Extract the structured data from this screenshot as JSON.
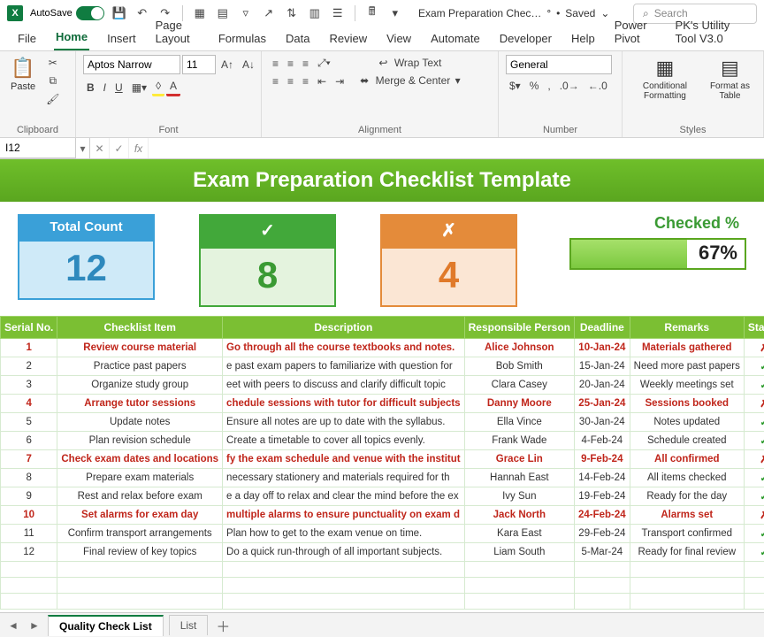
{
  "titlebar": {
    "autosave_label": "AutoSave",
    "autosave_state": "On",
    "doc_name": "Exam Preparation Chec…",
    "saved_status": "Saved",
    "search_placeholder": "Search"
  },
  "tabs": [
    "File",
    "Home",
    "Insert",
    "Page Layout",
    "Formulas",
    "Data",
    "Review",
    "View",
    "Automate",
    "Developer",
    "Help",
    "Power Pivot",
    "PK's Utility Tool V3.0"
  ],
  "active_tab": "Home",
  "ribbon": {
    "paste_label": "Paste",
    "clipboard_label": "Clipboard",
    "font_name": "Aptos Narrow",
    "font_size": "11",
    "font_label": "Font",
    "alignment_label": "Alignment",
    "wrap_text": "Wrap Text",
    "merge_center": "Merge & Center",
    "number_format": "General",
    "number_label": "Number",
    "cond_fmt": "Conditional Formatting",
    "fmt_table": "Format as Table",
    "styles_label": "Styles"
  },
  "formula_bar": {
    "cell_ref": "I12",
    "formula": ""
  },
  "banner_title": "Exam Preparation Checklist Template",
  "cards": {
    "total_label": "Total Count",
    "total_value": "12",
    "checked_value": "8",
    "unchecked_value": "4",
    "pct_label": "Checked %",
    "pct_value": "67%",
    "pct_fill": 67
  },
  "headers": [
    "Serial No.",
    "Checklist Item",
    "Description",
    "Responsible Person",
    "Deadline",
    "Remarks",
    "Status"
  ],
  "rows": [
    {
      "n": "1",
      "item": "Review course material",
      "desc": "Go through all the course textbooks and notes.",
      "who": "Alice Johnson",
      "date": "10-Jan-24",
      "rem": "Materials gathered",
      "ok": false,
      "flag": true
    },
    {
      "n": "2",
      "item": "Practice past papers",
      "desc": "e past exam papers to familiarize with question for",
      "who": "Bob Smith",
      "date": "15-Jan-24",
      "rem": "Need more past papers",
      "ok": true,
      "flag": false
    },
    {
      "n": "3",
      "item": "Organize study group",
      "desc": "eet with peers to discuss and clarify difficult topic",
      "who": "Clara Casey",
      "date": "20-Jan-24",
      "rem": "Weekly meetings set",
      "ok": true,
      "flag": false
    },
    {
      "n": "4",
      "item": "Arrange tutor sessions",
      "desc": "chedule sessions with tutor for difficult subjects",
      "who": "Danny Moore",
      "date": "25-Jan-24",
      "rem": "Sessions booked",
      "ok": false,
      "flag": true
    },
    {
      "n": "5",
      "item": "Update notes",
      "desc": "Ensure all notes are up to date with the syllabus.",
      "who": "Ella Vince",
      "date": "30-Jan-24",
      "rem": "Notes updated",
      "ok": true,
      "flag": false
    },
    {
      "n": "6",
      "item": "Plan revision schedule",
      "desc": "Create a timetable to cover all topics evenly.",
      "who": "Frank Wade",
      "date": "4-Feb-24",
      "rem": "Schedule created",
      "ok": true,
      "flag": false
    },
    {
      "n": "7",
      "item": "Check exam dates and locations",
      "desc": "fy the exam schedule and venue with the institut",
      "who": "Grace Lin",
      "date": "9-Feb-24",
      "rem": "All confirmed",
      "ok": false,
      "flag": true
    },
    {
      "n": "8",
      "item": "Prepare exam materials",
      "desc": "necessary stationery and materials required for th",
      "who": "Hannah East",
      "date": "14-Feb-24",
      "rem": "All items checked",
      "ok": true,
      "flag": false
    },
    {
      "n": "9",
      "item": "Rest and relax before exam",
      "desc": "e a day off to relax and clear the mind before the ex",
      "who": "Ivy Sun",
      "date": "19-Feb-24",
      "rem": "Ready for the day",
      "ok": true,
      "flag": false
    },
    {
      "n": "10",
      "item": "Set alarms for exam day",
      "desc": "multiple alarms to ensure punctuality on exam d",
      "who": "Jack North",
      "date": "24-Feb-24",
      "rem": "Alarms set",
      "ok": false,
      "flag": true
    },
    {
      "n": "11",
      "item": "Confirm transport arrangements",
      "desc": "Plan how to get to the exam venue on time.",
      "who": "Kara East",
      "date": "29-Feb-24",
      "rem": "Transport confirmed",
      "ok": true,
      "flag": false
    },
    {
      "n": "12",
      "item": "Final review of key topics",
      "desc": "Do a quick run-through of all important subjects.",
      "who": "Liam South",
      "date": "5-Mar-24",
      "rem": "Ready for final review",
      "ok": true,
      "flag": false
    }
  ],
  "sheet_tabs": {
    "active": "Quality Check List",
    "others": [
      "List"
    ]
  }
}
